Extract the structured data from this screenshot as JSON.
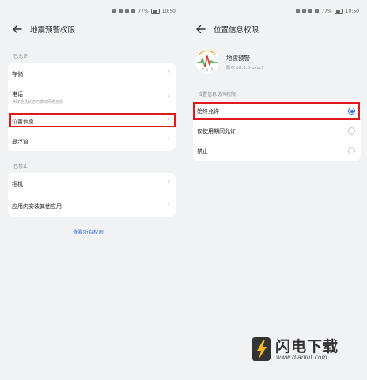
{
  "status_bar": {
    "battery": "77%",
    "time": "10:50"
  },
  "left": {
    "title": "地震预警权限",
    "allowed_label": "已允许",
    "allowed_items": [
      {
        "label": "存储"
      },
      {
        "label": "电话",
        "sub": "读取通话状态与移动网络信息"
      },
      {
        "label": "位置信息"
      },
      {
        "label": "悬浮窗"
      }
    ],
    "denied_label": "已禁止",
    "denied_items": [
      {
        "label": "相机"
      },
      {
        "label": "应用内安装其他应用"
      }
    ],
    "view_all": "查看所有权限"
  },
  "right": {
    "title": "位置信息权限",
    "app_name": "地震预警",
    "app_version": "版本 v8.3.0-bssc7",
    "section_label": "位置信息访问权限",
    "options": [
      {
        "label": "始终允许",
        "selected": true
      },
      {
        "label": "仅使用期间允许",
        "selected": false
      },
      {
        "label": "禁止",
        "selected": false
      }
    ]
  },
  "watermark": {
    "title": "闪电下载",
    "url": "www.dianlut.com"
  },
  "colors": {
    "highlight": "#e0191d",
    "accent": "#2f6ce5",
    "background": "#f1f2f4"
  }
}
